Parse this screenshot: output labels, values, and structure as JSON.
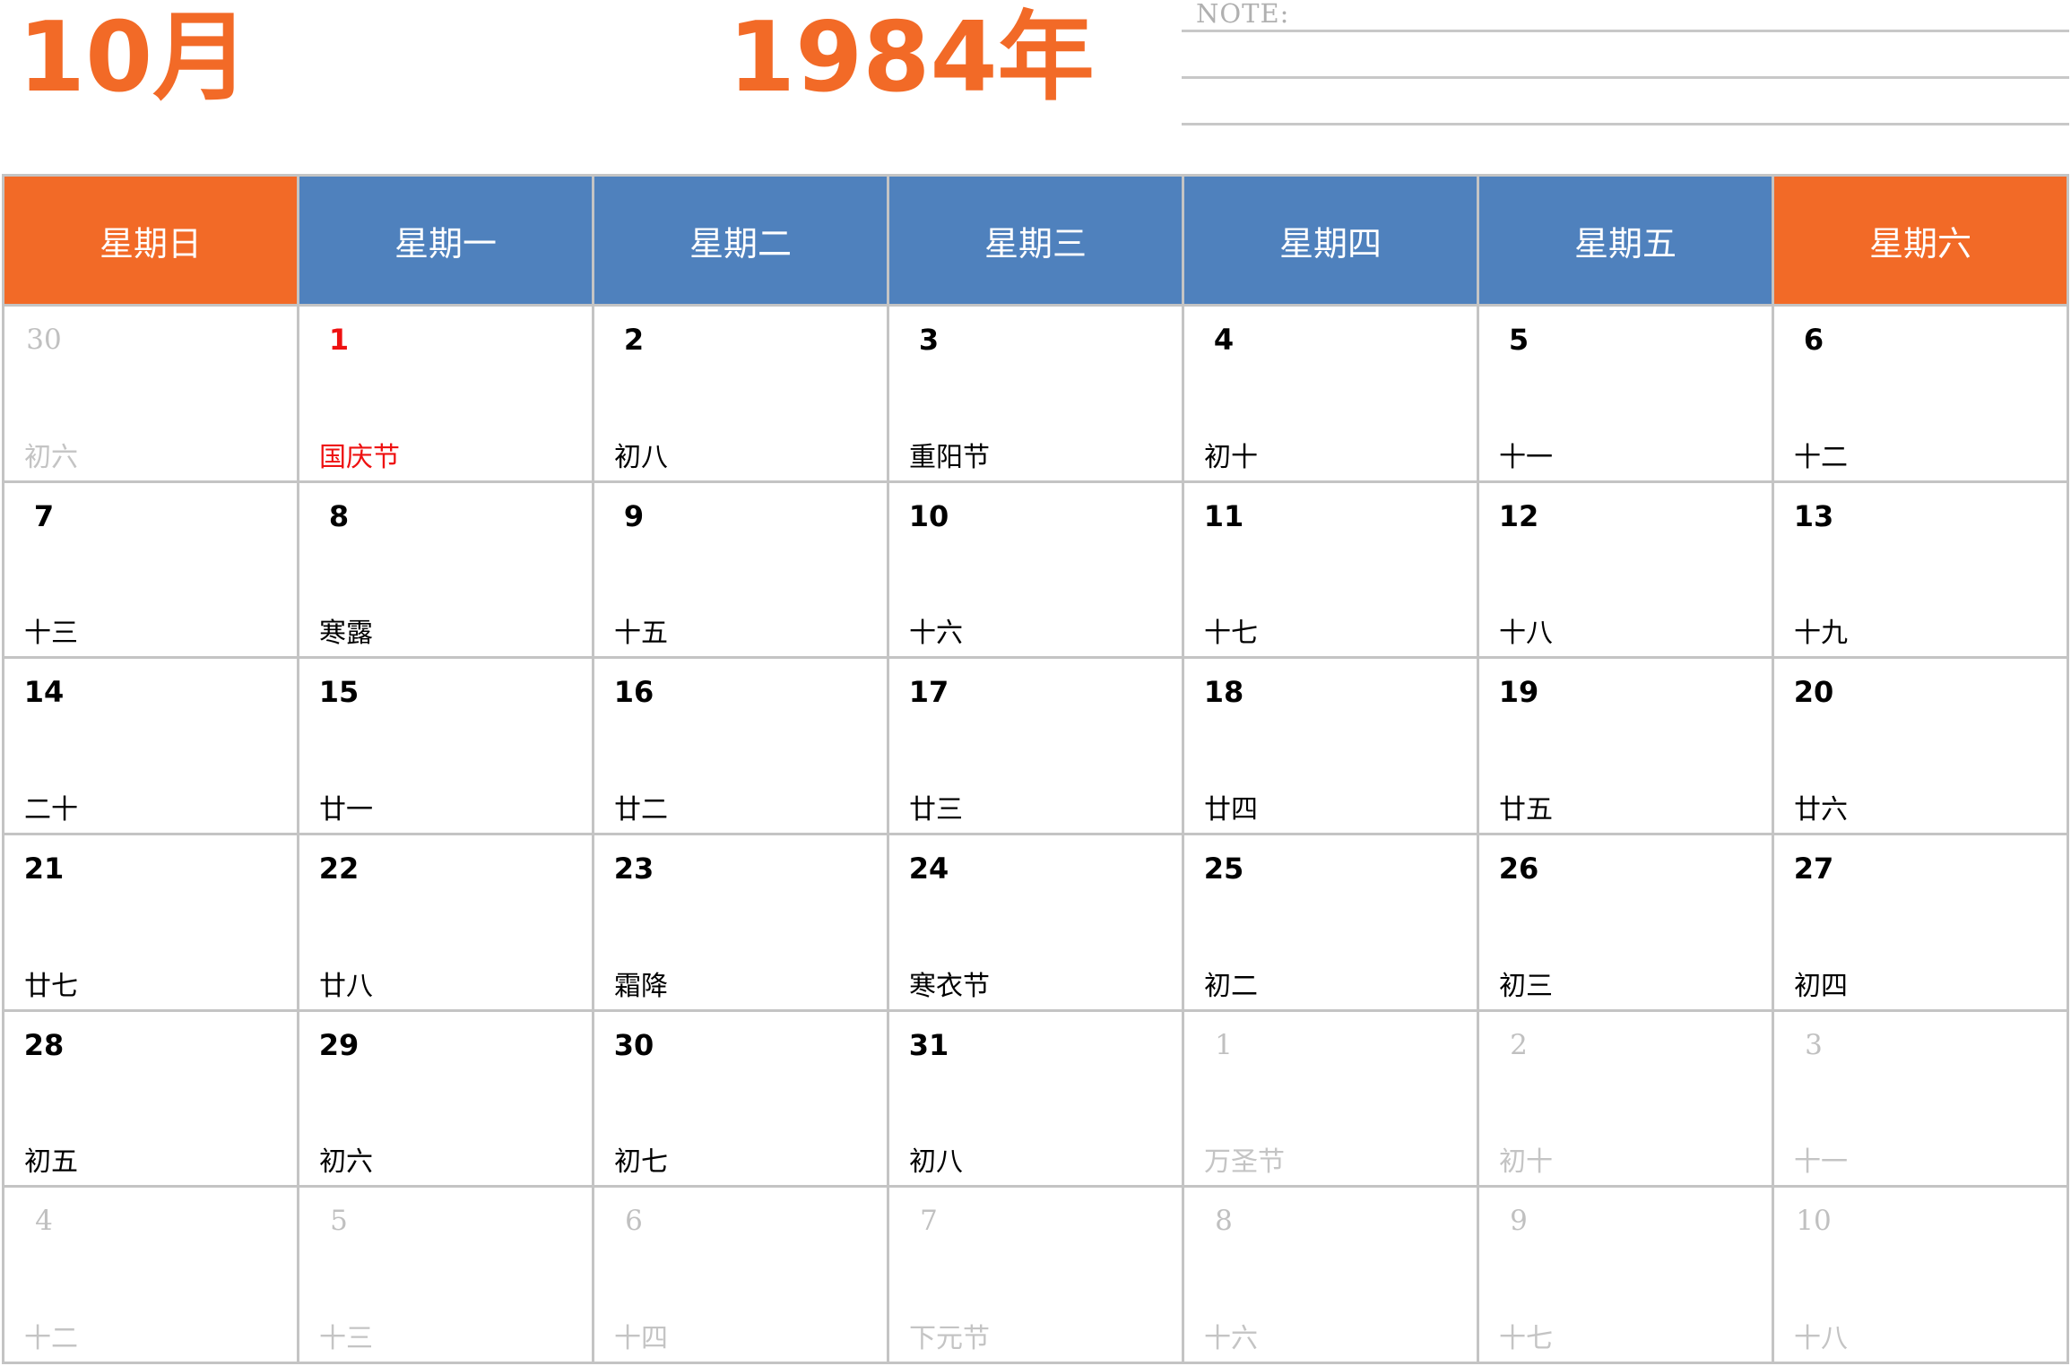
{
  "header": {
    "month": "10月",
    "year": "1984年",
    "note_label": "NOTE:"
  },
  "colors": {
    "accent": "#f26a27",
    "weekday_header": "#4f81bd",
    "holiday": "#ee1111",
    "grid": "#c4c4c4",
    "muted": "#c0c0c0"
  },
  "weekdays": [
    "星期日",
    "星期一",
    "星期二",
    "星期三",
    "星期四",
    "星期五",
    "星期六"
  ],
  "weeks": [
    [
      {
        "day": "30",
        "lunar": "初六",
        "out": true
      },
      {
        "day": "1",
        "lunar": "国庆节",
        "holiday": true
      },
      {
        "day": "2",
        "lunar": "初八"
      },
      {
        "day": "3",
        "lunar": "重阳节"
      },
      {
        "day": "4",
        "lunar": "初十"
      },
      {
        "day": "5",
        "lunar": "十一"
      },
      {
        "day": "6",
        "lunar": "十二"
      }
    ],
    [
      {
        "day": "7",
        "lunar": "十三"
      },
      {
        "day": "8",
        "lunar": "寒露"
      },
      {
        "day": "9",
        "lunar": "十五"
      },
      {
        "day": "10",
        "lunar": "十六"
      },
      {
        "day": "11",
        "lunar": "十七"
      },
      {
        "day": "12",
        "lunar": "十八"
      },
      {
        "day": "13",
        "lunar": "十九"
      }
    ],
    [
      {
        "day": "14",
        "lunar": "二十"
      },
      {
        "day": "15",
        "lunar": "廿一"
      },
      {
        "day": "16",
        "lunar": "廿二"
      },
      {
        "day": "17",
        "lunar": "廿三"
      },
      {
        "day": "18",
        "lunar": "廿四"
      },
      {
        "day": "19",
        "lunar": "廿五"
      },
      {
        "day": "20",
        "lunar": "廿六"
      }
    ],
    [
      {
        "day": "21",
        "lunar": "廿七"
      },
      {
        "day": "22",
        "lunar": "廿八"
      },
      {
        "day": "23",
        "lunar": "霜降"
      },
      {
        "day": "24",
        "lunar": "寒衣节"
      },
      {
        "day": "25",
        "lunar": "初二"
      },
      {
        "day": "26",
        "lunar": "初三"
      },
      {
        "day": "27",
        "lunar": "初四"
      }
    ],
    [
      {
        "day": "28",
        "lunar": "初五"
      },
      {
        "day": "29",
        "lunar": "初六"
      },
      {
        "day": "30",
        "lunar": "初七"
      },
      {
        "day": "31",
        "lunar": "初八"
      },
      {
        "day": "1",
        "lunar": "万圣节",
        "out": true
      },
      {
        "day": "2",
        "lunar": "初十",
        "out": true
      },
      {
        "day": "3",
        "lunar": "十一",
        "out": true
      }
    ],
    [
      {
        "day": "4",
        "lunar": "十二",
        "out": true
      },
      {
        "day": "5",
        "lunar": "十三",
        "out": true
      },
      {
        "day": "6",
        "lunar": "十四",
        "out": true
      },
      {
        "day": "7",
        "lunar": "下元节",
        "out": true
      },
      {
        "day": "8",
        "lunar": "十六",
        "out": true
      },
      {
        "day": "9",
        "lunar": "十七",
        "out": true
      },
      {
        "day": "10",
        "lunar": "十八",
        "out": true
      }
    ]
  ]
}
